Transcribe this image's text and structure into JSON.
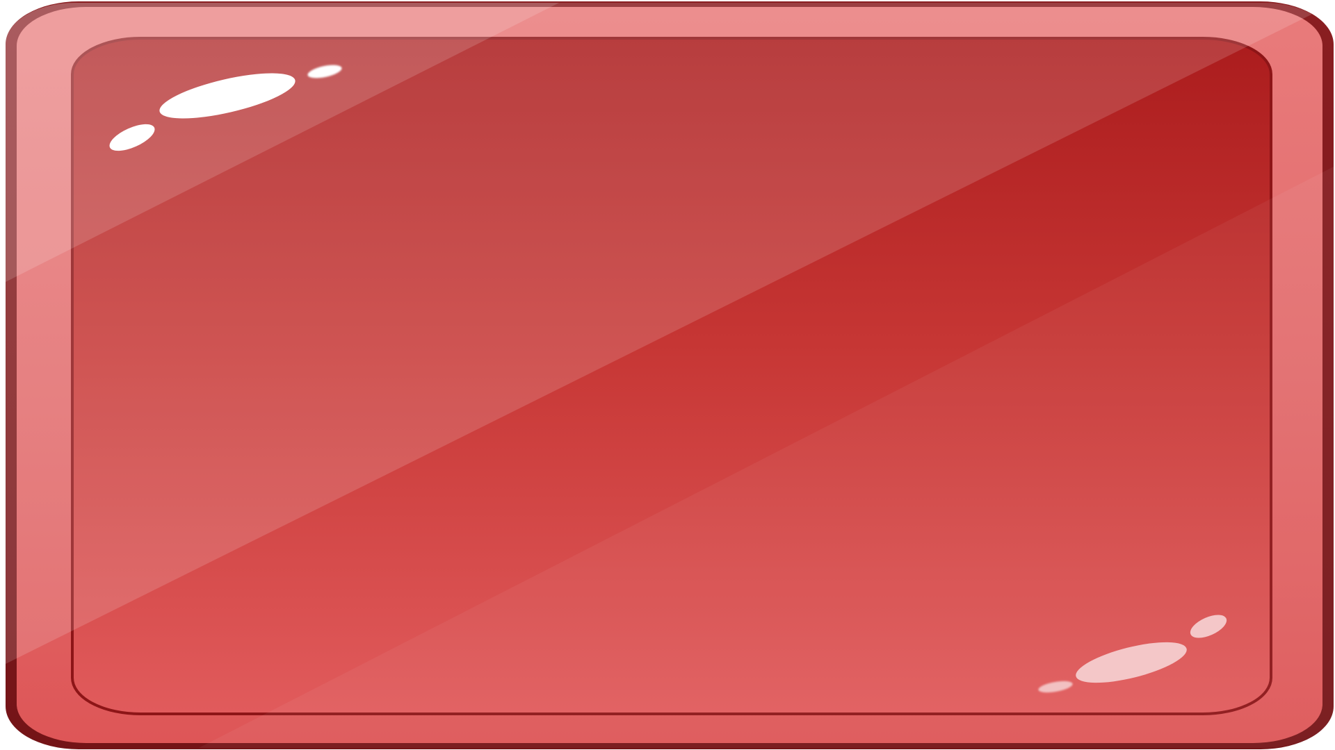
{
  "button": {
    "icon": "glossy-red-button",
    "colors": {
      "rim_dark": "#7f1a1d",
      "outer_bevel_top": "#e97b7b",
      "outer_bevel_bottom": "#de5657",
      "face_top": "#ab1c1d",
      "face_mid": "#c93a39",
      "face_bottom": "#e15b5c",
      "inner_rim": "#8d1517",
      "highlight": "#ffffff",
      "soft_highlight": "#f4c7c8"
    }
  }
}
